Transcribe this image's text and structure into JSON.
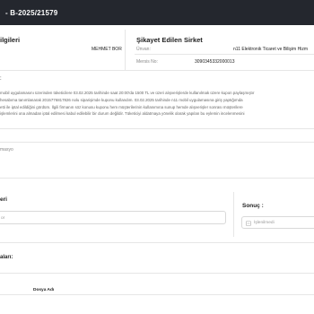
{
  "header": {
    "title": "- B-2025/21579"
  },
  "sections": {
    "customer_info_title": "ilgileri",
    "company_title": "Şikayet Edilen Sirket",
    "desc_label_fragment": ":",
    "second_label": "masyo",
    "notes_title": "eri",
    "result_title": "Sonuç :",
    "attachments_title": "aları:",
    "file_name_header": "Dosya Adı"
  },
  "customer": {
    "name": "MEHMET BOR"
  },
  "company": {
    "title_label": "Ünvan:",
    "title_value": "n11 Elektronik Ticaret ve Bilişim Hizm",
    "mersis_label": "Mersis No:",
    "mersis_value": "3090345332000013"
  },
  "description_lines": [
    "mobil uygulamasını üzerinden tüketicilere 03.02.2025 tarihinde saat 20:00'da 1500 TL ve üzeri alışverişlerde kullanılmak üzere kupon paylaşmıştır",
    "hesabıma tanımlanarak 2015776817826 nolu siparişimde kuponu kullandım. 03.02.2025 tarihinde n11 mobil uygulamasına giriş yaptığımda",
    "etti ile iptal edildiğini gördüm. İlgili firmanın söz konusu kuponu hem müşterilerinin kullanımına sunup hemde alışverişler sonrası müşterilere",
    "işlemlerini ona almadan iptal edilmesi kabul edilebilir bir durum değildir. Tüketiciyi aldatmaya yönelik olarak yapılan bu eylemin incelenmesini"
  ],
  "notes": {
    "placeholder": "or"
  },
  "result": {
    "value": "İşlenilmedi",
    "icon": "status-icon"
  }
}
